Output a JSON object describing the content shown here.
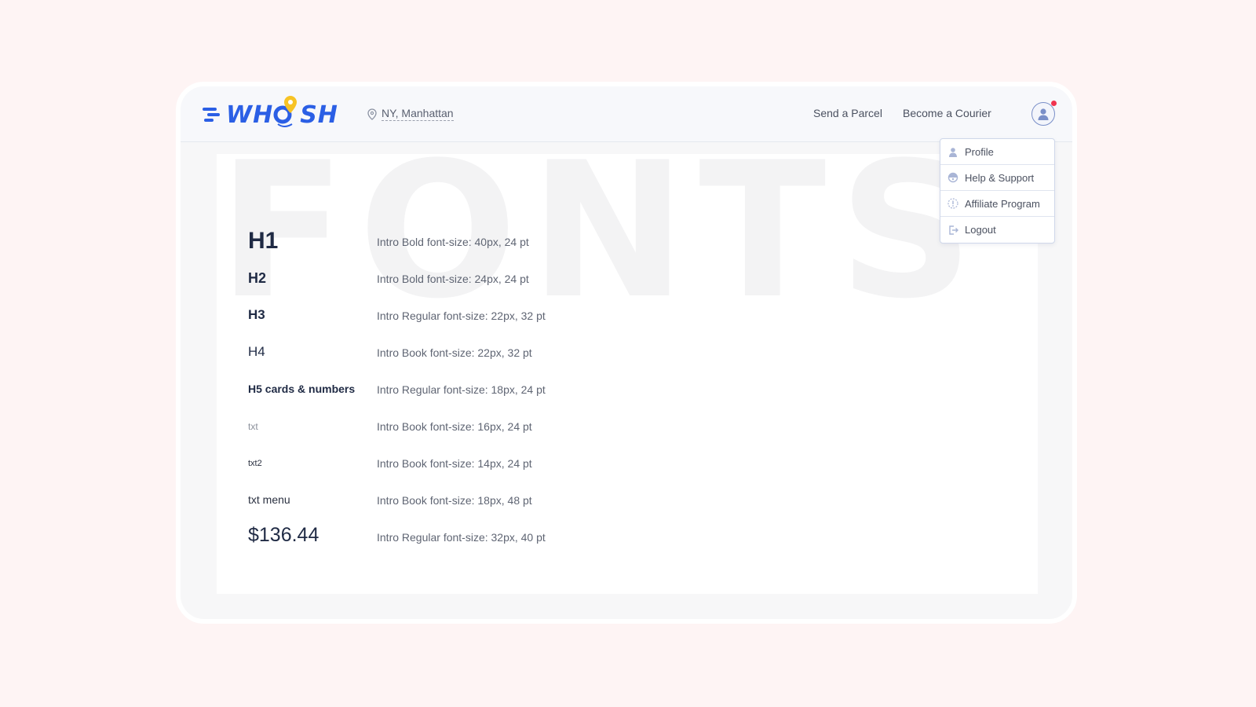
{
  "header": {
    "logo": {
      "part1": "WH",
      "part2": "O",
      "part3": "SH"
    },
    "location": "NY, Manhattan",
    "nav": [
      "Send a Parcel",
      "Become a Courier"
    ]
  },
  "content": {
    "background_word": "FONTS",
    "rows": [
      {
        "name": "H1",
        "desc": "Intro Bold  font-size: 40px, 24 pt"
      },
      {
        "name": "H2",
        "desc": "Intro Bold  font-size: 24px, 24 pt"
      },
      {
        "name": "H3",
        "desc": "Intro Regular  font-size: 22px, 32 pt"
      },
      {
        "name": "H4",
        "desc": "Intro Book  font-size: 22px, 32 pt"
      },
      {
        "name": "H5 cards & numbers",
        "desc": "Intro Regular  font-size: 18px, 24 pt"
      },
      {
        "name": "txt",
        "desc": "Intro Book  font-size: 16px, 24 pt"
      },
      {
        "name": "txt2",
        "desc": "Intro Book  font-size: 14px, 24 pt"
      },
      {
        "name": "txt menu",
        "desc": "Intro Book  font-size: 18px, 48 pt"
      },
      {
        "name": "$136.44",
        "desc": "Intro Regular  font-size: 32px, 40 pt"
      }
    ]
  },
  "user_menu": {
    "items": [
      {
        "label": "Profile",
        "icon": "user-icon"
      },
      {
        "label": "Help & Support",
        "icon": "support-icon"
      },
      {
        "label": "Affiliate Program",
        "icon": "affiliate-icon"
      },
      {
        "label": "Logout",
        "icon": "logout-icon"
      }
    ]
  },
  "colors": {
    "brand_blue": "#2b5fe5",
    "brand_yellow": "#f7c325",
    "notification_red": "#f0344f",
    "page_background": "#fef4f4"
  }
}
